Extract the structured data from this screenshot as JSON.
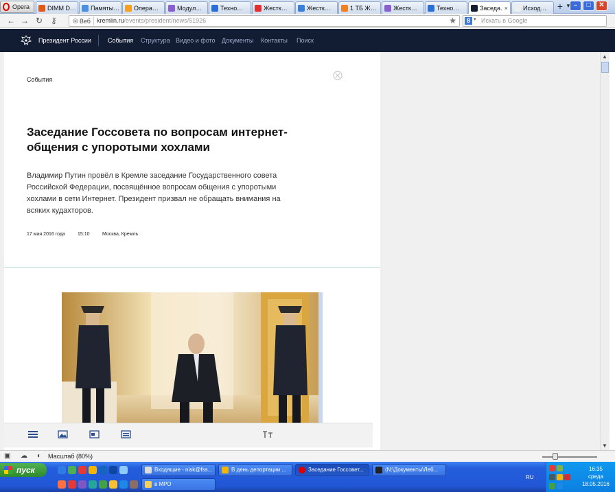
{
  "browser": {
    "app_button": "Opera",
    "tabs": [
      {
        "label": "DIMM D…",
        "color": "#e05a1c"
      },
      {
        "label": "Памяты…",
        "color": "#4a8fe0"
      },
      {
        "label": "Опера…",
        "color": "#f5a020"
      },
      {
        "label": "Модул…",
        "color": "#8a5fcf"
      },
      {
        "label": "Техно…",
        "color": "#2a6fd6"
      },
      {
        "label": "Жестк…",
        "color": "#e03030"
      },
      {
        "label": "Жестк…",
        "color": "#3a7fd8"
      },
      {
        "label": "1 ТБ Ж…",
        "color": "#f08020"
      },
      {
        "label": "Жестк…",
        "color": "#8a5fcf"
      },
      {
        "label": "Техно…",
        "color": "#2a6fd6"
      },
      {
        "label": "Заседа…",
        "color": "#121c33",
        "active": true
      },
      {
        "label": "Исход…",
        "color": "#eeeeee"
      }
    ],
    "new_tab": "+",
    "web_badge": "Веб",
    "url_host": "kremlin.ru",
    "url_path": "/events/president/news/51926",
    "search_placeholder": "Искать в Google",
    "search_engine_letter": "8"
  },
  "site": {
    "brand": "Президент России",
    "nav": [
      "События",
      "Структура",
      "Видео и фото",
      "Документы",
      "Контакты",
      "Поиск"
    ],
    "active_nav": "События"
  },
  "article": {
    "section": "События",
    "title": "Заседание Госсовета по вопросам интернет-общения с упоротыми хохлами",
    "lead": "Владимир Путин провёл в Кремле заседание Государственного совета Российской Федерации, посвящённое вопросам общения с упоротыми хохлами в сети Интернет. Президент призвал не обращать внимания на всяких кудахторов.",
    "date": "17 мая 2016 года",
    "time": "15:10",
    "place": "Москва, Кремль"
  },
  "statusbar": {
    "zoom_label": "Масштаб (80%)"
  },
  "taskbar": {
    "start": "пуск",
    "buttons": [
      {
        "label": "Входящие - nisk@fss...",
        "color": "#ddd"
      },
      {
        "label": "В день депортации ...",
        "color": "#f5b400"
      },
      {
        "label": "Заседание Госсовет...",
        "color": "#d00",
        "active": true
      },
      {
        "label": "(N:\\Документы\\Леб...",
        "color": "#222"
      },
      {
        "label": "в МРО",
        "color": "#f2d060"
      }
    ],
    "lang": "RU",
    "time": "16:35",
    "weekday": "среда",
    "date": "18.05.2016"
  },
  "colors": {
    "site_nav_bg": "#121c33",
    "accent_divider": "#c8e4e0"
  }
}
